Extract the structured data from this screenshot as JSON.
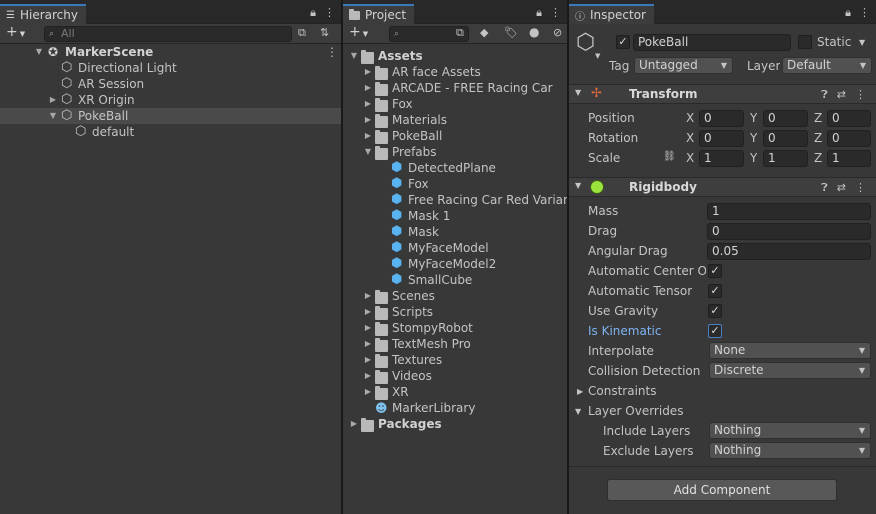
{
  "hierarchy": {
    "tab_label": "Hierarchy",
    "search_placeholder": "All",
    "items": [
      {
        "label": "MarkerScene"
      },
      {
        "label": "Directional Light"
      },
      {
        "label": "AR Session"
      },
      {
        "label": "XR Origin"
      },
      {
        "label": "PokeBall"
      },
      {
        "label": "default"
      }
    ]
  },
  "project": {
    "tab_label": "Project",
    "items": [
      {
        "label": "Assets"
      },
      {
        "label": "AR face Assets"
      },
      {
        "label": "ARCADE - FREE Racing Car"
      },
      {
        "label": "Fox"
      },
      {
        "label": "Materials"
      },
      {
        "label": "PokeBall"
      },
      {
        "label": "Prefabs"
      },
      {
        "label": "DetectedPlane"
      },
      {
        "label": "Fox"
      },
      {
        "label": "Free Racing Car Red Variant"
      },
      {
        "label": "Mask 1"
      },
      {
        "label": "Mask"
      },
      {
        "label": "MyFaceModel"
      },
      {
        "label": "MyFaceModel2"
      },
      {
        "label": "SmallCube"
      },
      {
        "label": "Scenes"
      },
      {
        "label": "Scripts"
      },
      {
        "label": "StompyRobot"
      },
      {
        "label": "TextMesh Pro"
      },
      {
        "label": "Textures"
      },
      {
        "label": "Videos"
      },
      {
        "label": "XR"
      },
      {
        "label": "MarkerLibrary"
      },
      {
        "label": "Packages"
      }
    ]
  },
  "inspector": {
    "tab_label": "Inspector",
    "object_name": "PokeBall",
    "static_label": "Static",
    "tag_label": "Tag",
    "tag_value": "Untagged",
    "layer_label": "Layer",
    "layer_value": "Default",
    "transform": {
      "title": "Transform",
      "position_label": "Position",
      "rotation_label": "Rotation",
      "scale_label": "Scale",
      "axis_x": "X",
      "axis_y": "Y",
      "axis_z": "Z",
      "position": [
        "0",
        "0",
        "0"
      ],
      "rotation": [
        "0",
        "0",
        "0"
      ],
      "scale": [
        "1",
        "1",
        "1"
      ]
    },
    "rigidbody": {
      "title": "Rigidbody",
      "mass_label": "Mass",
      "mass": "1",
      "drag_label": "Drag",
      "drag": "0",
      "angular_drag_label": "Angular Drag",
      "angular_drag": "0.05",
      "auto_center_label": "Automatic Center Of M",
      "auto_tensor_label": "Automatic Tensor",
      "use_gravity_label": "Use Gravity",
      "is_kinematic_label": "Is Kinematic",
      "interpolate_label": "Interpolate",
      "interpolate": "None",
      "collision_label": "Collision Detection",
      "collision": "Discrete",
      "constraints_label": "Constraints",
      "layer_overrides_label": "Layer Overrides",
      "include_layers_label": "Include Layers",
      "include_layers": "Nothing",
      "exclude_layers_label": "Exclude Layers",
      "exclude_layers": "Nothing"
    },
    "add_component_label": "Add Component"
  },
  "colors": {
    "accent": "#3a79bb",
    "prefab_icon": "#58b3f0",
    "kinematic_label": "#7fb2f0"
  }
}
